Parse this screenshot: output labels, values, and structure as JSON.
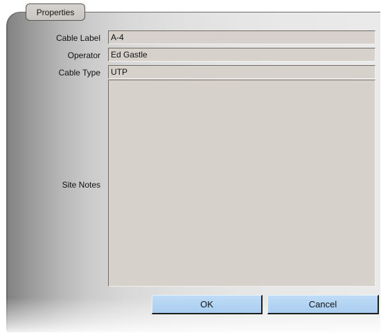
{
  "groupbox": {
    "title": "Properties"
  },
  "fields": {
    "cable_label": {
      "label": "Cable Label",
      "value": "A-4"
    },
    "operator": {
      "label": "Operator",
      "value": "Ed Gastle"
    },
    "cable_type": {
      "label": "Cable Type",
      "value": "UTP"
    },
    "site_notes": {
      "label": "Site Notes",
      "value": ""
    }
  },
  "buttons": {
    "ok_label": "OK",
    "cancel_label": "Cancel"
  },
  "colors": {
    "field_background": "#d6d1cb",
    "button_background": "#b5d5f4"
  }
}
